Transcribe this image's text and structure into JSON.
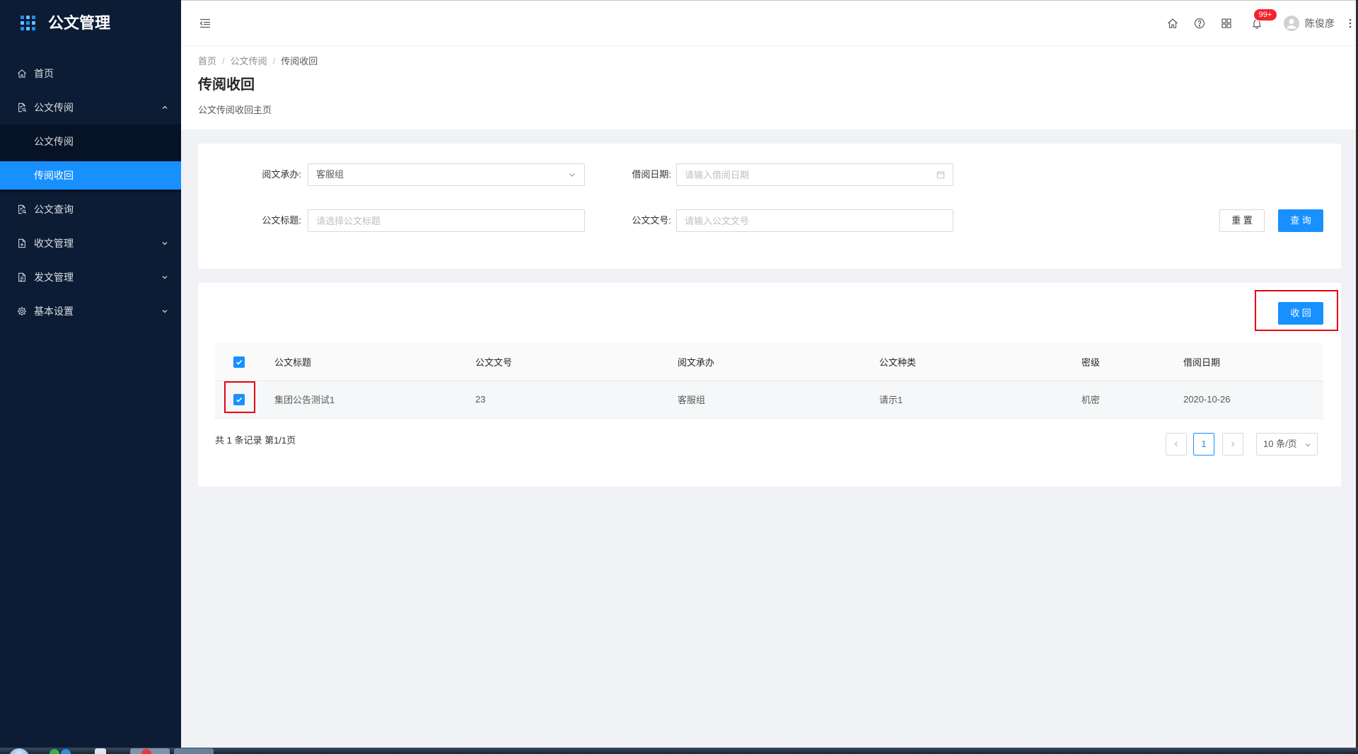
{
  "app": {
    "title": "公文管理",
    "logo_icon": "apps-grid-icon"
  },
  "sidebar": {
    "items": [
      {
        "label": "首页",
        "icon": "home-icon"
      },
      {
        "label": "公文传阅",
        "icon": "file-search-icon",
        "expanded": true,
        "children": [
          {
            "label": "公文传阅",
            "selected": false
          },
          {
            "label": "传阅收回",
            "selected": true
          }
        ]
      },
      {
        "label": "公文查询",
        "icon": "file-search-icon"
      },
      {
        "label": "收文管理",
        "icon": "file-add-icon",
        "expanded": false
      },
      {
        "label": "发文管理",
        "icon": "file-text-icon",
        "expanded": false
      },
      {
        "label": "基本设置",
        "icon": "setting-icon",
        "expanded": false
      }
    ]
  },
  "header": {
    "notification_count": "99+",
    "user_name": "陈俊彦",
    "actions": [
      "menu-fold-icon",
      "home-icon",
      "question-circle-icon",
      "appstore-icon",
      "bell-icon",
      "more-vertical-icon"
    ]
  },
  "page": {
    "breadcrumb": [
      "首页",
      "公文传阅",
      "传阅收回"
    ],
    "breadcrumb_separator": "/",
    "title": "传阅收回",
    "subtitle": "公文传阅收回主页"
  },
  "filter": {
    "handler": {
      "label": "阅文承办:",
      "value": "客服组"
    },
    "borrow_date": {
      "label": "借阅日期:",
      "placeholder": "请输入借阅日期"
    },
    "doc_title": {
      "label": "公文标题:",
      "placeholder": "请选择公文标题"
    },
    "doc_number": {
      "label": "公文文号:",
      "placeholder": "请输入公文文号"
    },
    "reset_label": "重 置",
    "search_label": "查 询"
  },
  "table": {
    "recall_label": "收 回",
    "select_all_checked": true,
    "columns": [
      "公文标题",
      "公文文号",
      "阅文承办",
      "公文种类",
      "密级",
      "借阅日期"
    ],
    "rows": [
      {
        "checked": true,
        "cells": [
          "集团公告测试1",
          "23",
          "客服组",
          "请示1",
          "机密",
          "2020-10-26"
        ]
      }
    ]
  },
  "pagination": {
    "summary": "共 1 条记录 第1/1页",
    "current_page": "1",
    "page_size": "10 条/页"
  },
  "colors": {
    "sidebar_bg": "#0c1c35",
    "submenu_bg": "#061226",
    "primary": "#1890ff",
    "badge": "#f5222d",
    "highlight_box": "#e60012",
    "page_bg": "#f0f2f5"
  }
}
